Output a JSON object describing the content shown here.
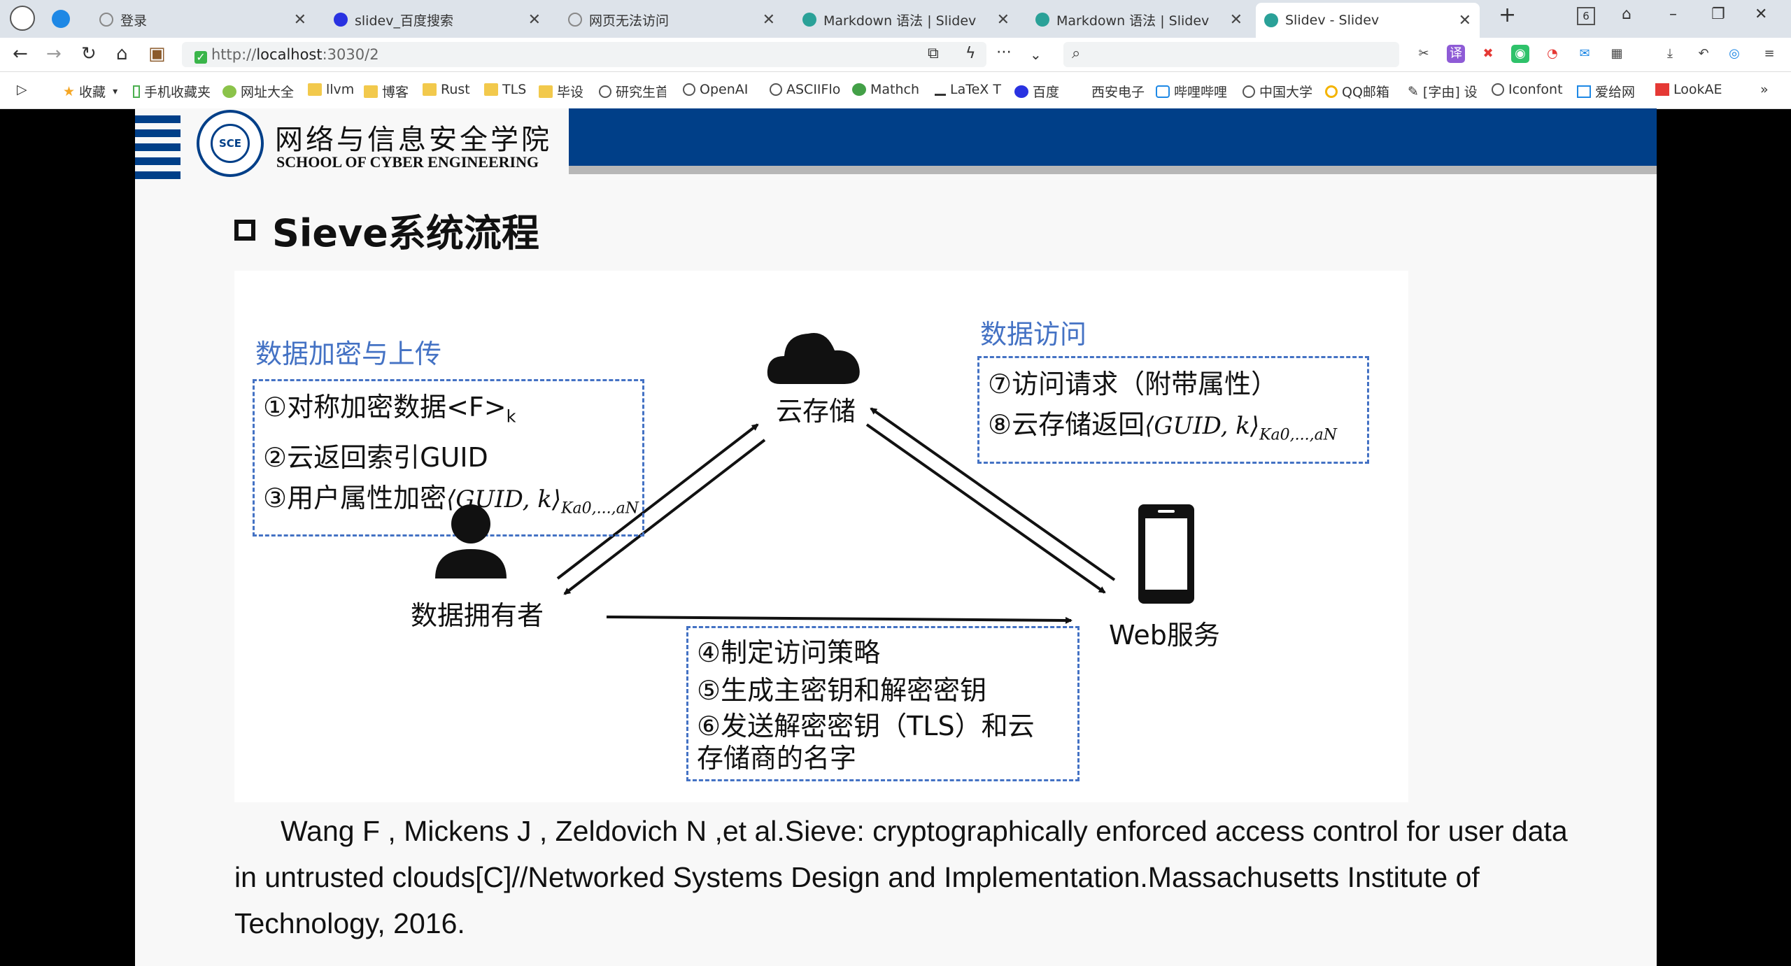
{
  "browser": {
    "tabs": [
      {
        "label": "登录",
        "icon": "globe-icon"
      },
      {
        "label": "slidev_百度搜索",
        "icon": "baidu-icon"
      },
      {
        "label": "网页无法访问",
        "icon": "globe-icon"
      },
      {
        "label": "Markdown 语法 | Slidev",
        "icon": "slidev-icon"
      },
      {
        "label": "Markdown 语法 | Slidev",
        "icon": "slidev-icon"
      },
      {
        "label": "Slidev - Slidev",
        "icon": "slidev-icon",
        "active": true
      }
    ],
    "tab_count": "6",
    "url_prefix": "http://",
    "url_host": "localhost",
    "url_path": ":3030/2",
    "bookmarks": [
      "收藏",
      "手机收藏夹",
      "网址大全",
      "llvm",
      "博客",
      "Rust",
      "TLS",
      "毕设",
      "研究生首",
      "OpenAI",
      "ASCIIFlo",
      "Mathch",
      "LaTeX T",
      "百度",
      "西安电子",
      "哔哩哔哩",
      "中国大学",
      "QQ邮箱",
      "[字由] 设",
      "Iconfont",
      "爱给网",
      "LookAE"
    ]
  },
  "slide": {
    "logo_abbr": "SCE",
    "school_cn": "网络与信息安全学院",
    "school_en": "SCHOOL OF CYBER ENGINEERING",
    "title": "Sieve系统流程",
    "diagram": {
      "section_upload": "数据加密与上传",
      "section_access": "数据访问",
      "upload_steps": [
        "①对称加密数据<F>",
        "②云返回索引GUID",
        "③用户属性加密"
      ],
      "upload_step1_sub": "k",
      "step3_math": "⟨GUID, k⟩",
      "step3_sub": "Ka0,...,aN",
      "access_steps": [
        "⑦访问请求（附带属性）",
        "⑧云存储返回"
      ],
      "step8_math": "⟨GUID, k⟩",
      "step8_sub": "Ka0,...,aN",
      "policy_steps": [
        "④制定访问策略",
        "⑤生成主密钥和解密密钥",
        "⑥发送解密密钥（TLS）和云",
        "存储商的名字"
      ],
      "node_cloud": "云存储",
      "node_owner": "数据拥有者",
      "node_web": "Web服务"
    },
    "reference": "Wang F , Mickens J , Zeldovich N ,et al.Sieve: cryptographically enforced access control for user data in untrusted clouds[C]//Networked Systems Design and Implementation.Massachusetts Institute of Technology, 2016."
  },
  "colors": {
    "accent": "#003f88",
    "diagram_blue": "#4472c4"
  }
}
